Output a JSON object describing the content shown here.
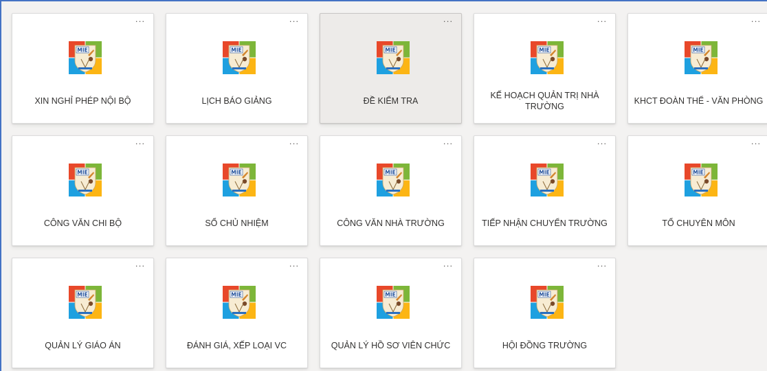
{
  "tiles": [
    {
      "label": "XIN NGHỈ PHÉP NỘI BỘ",
      "more": "···"
    },
    {
      "label": "LỊCH BÁO GIẢNG",
      "more": "···"
    },
    {
      "label": "ĐỀ KIỂM TRA",
      "more": "···"
    },
    {
      "label": "KẾ HOẠCH QUẢN TRỊ NHÀ TRƯỜNG",
      "more": "···"
    },
    {
      "label": "KHCT ĐOÀN THỂ - VĂN PHÒNG",
      "more": "···"
    },
    {
      "label": "CÔNG VĂN CHI BỘ",
      "more": "···"
    },
    {
      "label": "SỔ CHỦ NHIỆM",
      "more": "···"
    },
    {
      "label": "CÔNG VĂN NHÀ TRƯỜNG",
      "more": "···"
    },
    {
      "label": "TIẾP NHẬN CHUYỂN TRƯỜNG",
      "more": "···"
    },
    {
      "label": "TỔ CHUYÊN MÔN",
      "more": "···"
    },
    {
      "label": "QUẢN LÝ GIÁO ÁN",
      "more": "···"
    },
    {
      "label": "ĐÁNH GIÁ, XẾP LOẠI VC",
      "more": "···"
    },
    {
      "label": "QUẢN LÝ HỒ SƠ VIÊN CHỨC",
      "more": "···"
    },
    {
      "label": "HỘI ĐỒNG TRƯỜNG",
      "more": "···"
    }
  ],
  "logo": {
    "text": "MIE",
    "icon": "mie-logo-icon",
    "colors": {
      "red": "#e8482a",
      "green": "#7db639",
      "blue": "#1ea0e0",
      "yellow": "#fcb514",
      "shield": "#f7ecd3"
    }
  },
  "colors": {
    "frame_border": "#4472c4",
    "background": "#f3f2f1",
    "card": "#ffffff",
    "card_hover": "#edebe9"
  }
}
